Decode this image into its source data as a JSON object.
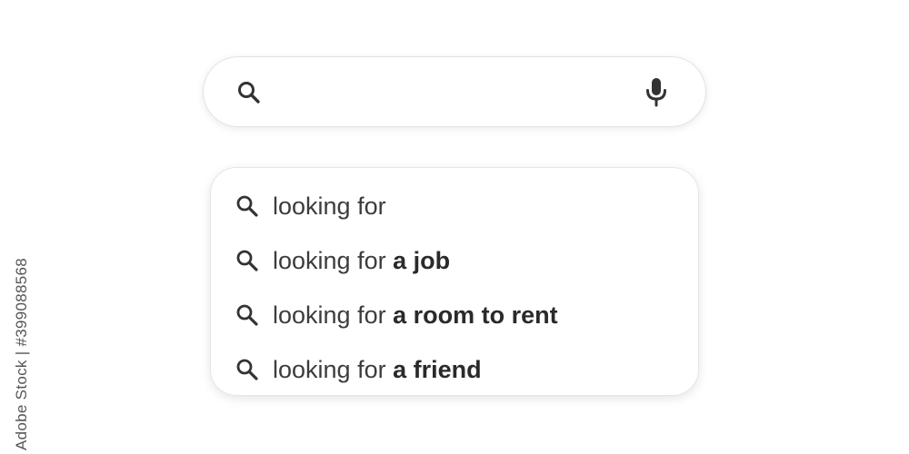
{
  "search": {
    "value": "",
    "placeholder": "",
    "search_icon": "search-icon",
    "mic_icon": "microphone-icon"
  },
  "suggestions": [
    {
      "base": "looking for",
      "completion": ""
    },
    {
      "base": "looking for ",
      "completion": "a job"
    },
    {
      "base": "looking for ",
      "completion": "a room to rent"
    },
    {
      "base": "looking for ",
      "completion": "a friend"
    }
  ],
  "watermark": {
    "side_text": "Adobe Stock | #399088568"
  },
  "colors": {
    "text": "#333333",
    "border": "#e3e3e3",
    "background": "#ffffff"
  }
}
